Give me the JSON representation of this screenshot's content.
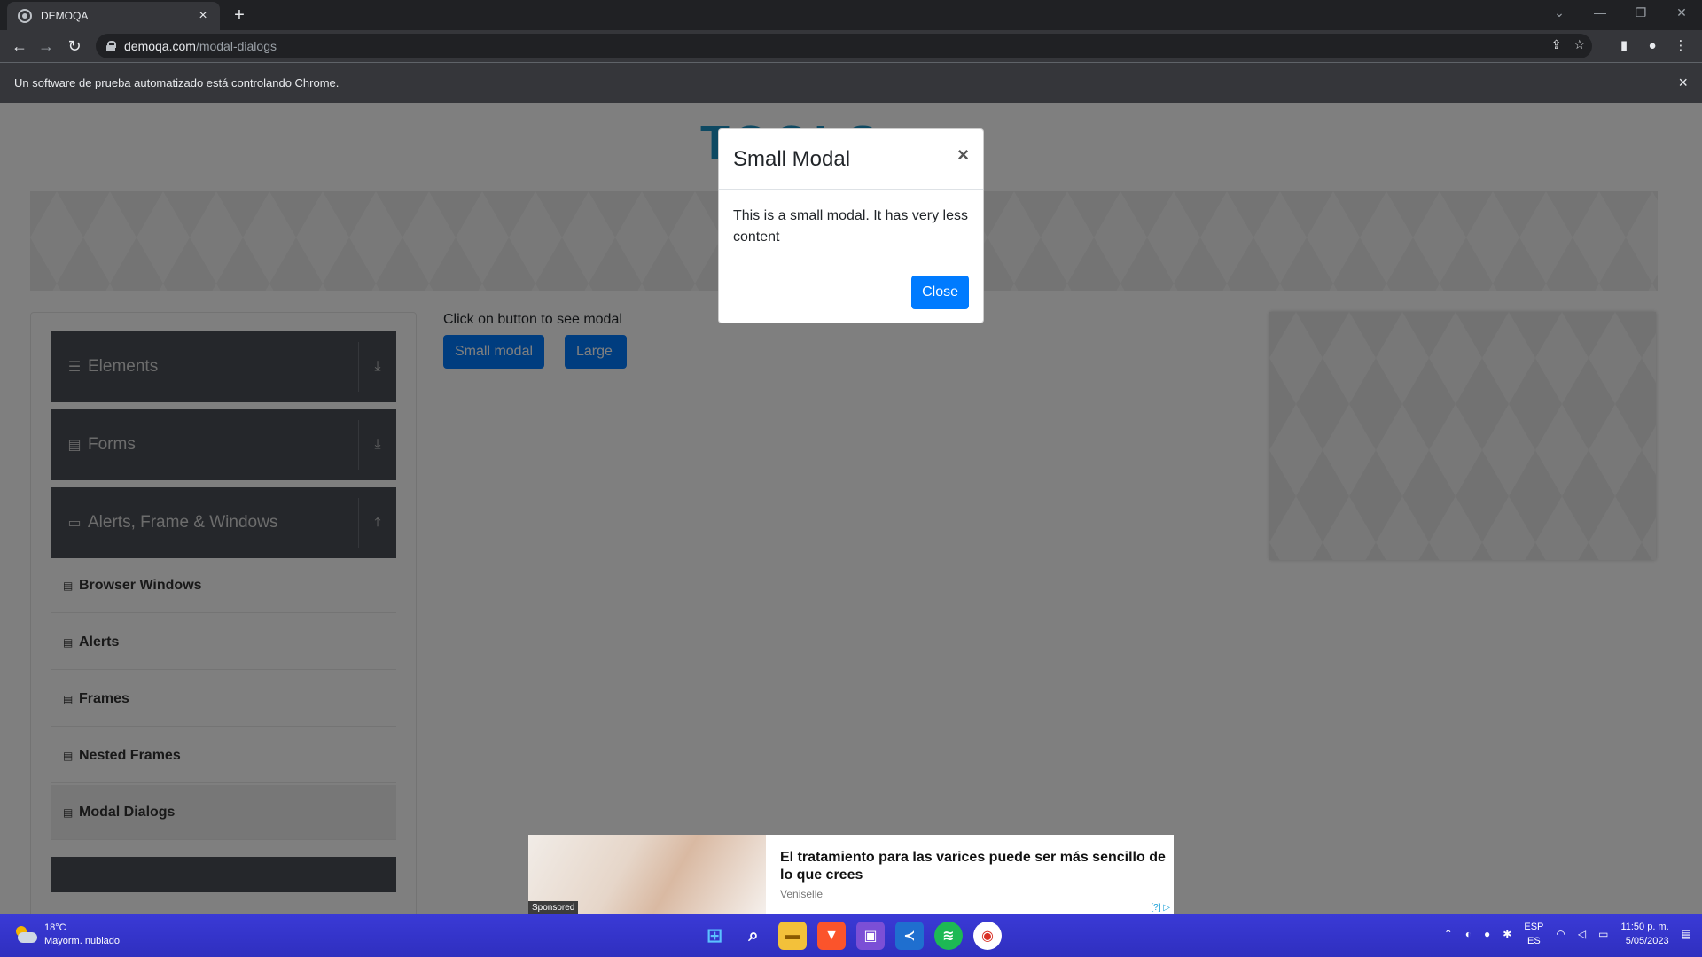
{
  "browser": {
    "tab_title": "DEMOQA",
    "tab_close": "×",
    "new_tab": "+",
    "url_host": "demoqa.com",
    "url_path": "/modal-dialogs",
    "infobar_text": "Un software de prueba automatizado está controlando Chrome.",
    "infobar_close": "×",
    "window_minimize": "—",
    "window_restore": "❐",
    "window_close": "✕",
    "tab_search": "⌄"
  },
  "page": {
    "logo_text": "TOOLS",
    "instruction": "Click on button to see modal",
    "small_modal_btn": "Small modal",
    "large_modal_btn": "Large modal"
  },
  "sidebar": {
    "groups": [
      {
        "label": "Elements",
        "icon": "hamburger-icon",
        "arrow": "download-arrow-icon"
      },
      {
        "label": "Forms",
        "icon": "document-icon",
        "arrow": "download-arrow-icon"
      },
      {
        "label": "Alerts, Frame & Windows",
        "icon": "window-icon",
        "arrow": "upload-arrow-icon"
      }
    ],
    "items": [
      {
        "label": "Browser Windows"
      },
      {
        "label": "Alerts"
      },
      {
        "label": "Frames"
      },
      {
        "label": "Nested Frames"
      },
      {
        "label": "Modal Dialogs"
      }
    ]
  },
  "modal": {
    "title": "Small Modal",
    "x": "×",
    "body": "This is a small modal. It has very less content",
    "close": "Close"
  },
  "ad": {
    "headline": "El tratamiento para las varices puede ser más sencillo de lo que crees",
    "brand": "Veniselle",
    "sponsored": "Sponsored",
    "choices": "[?] ▷"
  },
  "taskbar": {
    "temp": "18°C",
    "condition": "Mayorm. nublado",
    "lang_top": "ESP",
    "lang_bottom": "ES",
    "time": "11:50 p. m.",
    "date": "5/05/2023"
  },
  "colors": {
    "primary": "#007bff",
    "sidebar_header": "#4a4f57",
    "taskbar": "#2f2fbf"
  }
}
